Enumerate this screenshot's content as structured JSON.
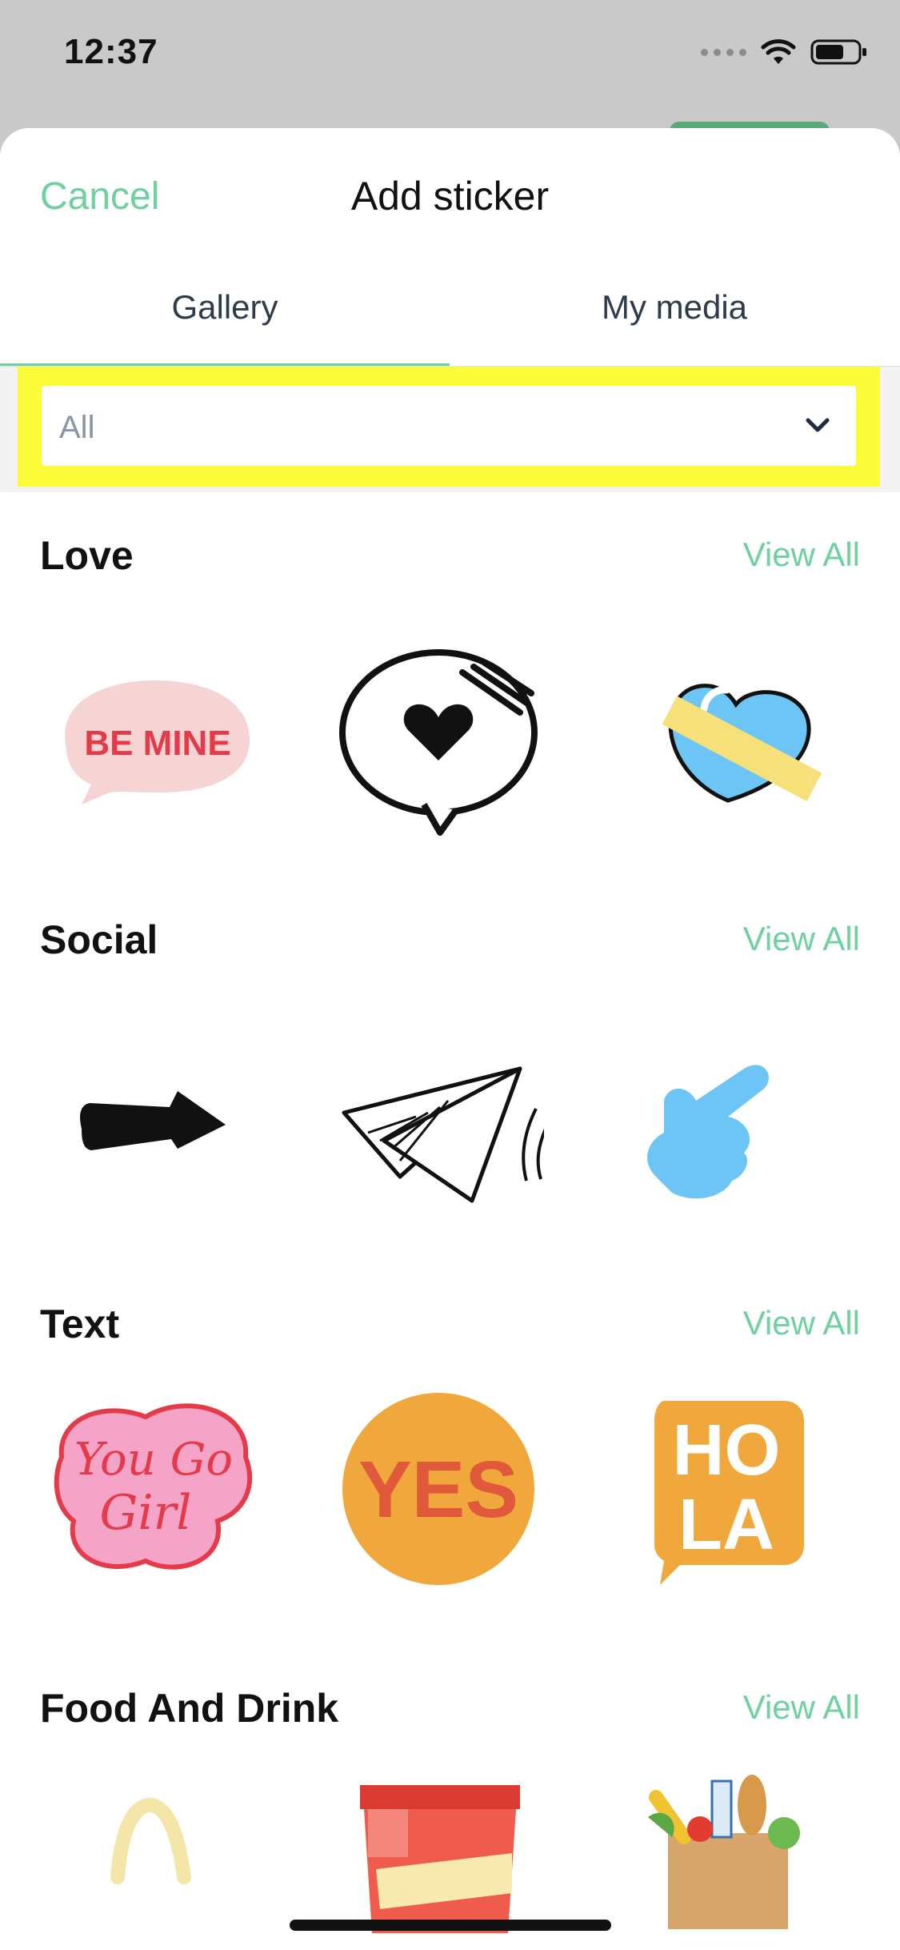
{
  "status": {
    "time": "12:37"
  },
  "nav": {
    "cancel": "Cancel",
    "title": "Add sticker"
  },
  "tabs": [
    {
      "label": "Gallery",
      "active": true
    },
    {
      "label": "My media",
      "active": false
    }
  ],
  "filter": {
    "value": "All"
  },
  "sections": [
    {
      "title": "Love",
      "view_all": "View All",
      "stickers": [
        "be-mine-speech-bubble",
        "heart-speech-bubble",
        "blue-heart-with-tape"
      ]
    },
    {
      "title": "Social",
      "view_all": "View All",
      "stickers": [
        "black-arrow",
        "paper-plane",
        "pointing-hand"
      ]
    },
    {
      "title": "Text",
      "view_all": "View All",
      "stickers": [
        "you-go-girl-text",
        "yes-circle",
        "hola-speech-bubble"
      ]
    },
    {
      "title": "Food And Drink",
      "view_all": "View All",
      "stickers": [
        "noodle",
        "snack-bag",
        "grocery-bag"
      ]
    }
  ],
  "sticker_text": {
    "be_mine": "BE MINE",
    "you_go_girl_1": "You Go",
    "you_go_girl_2": "Girl",
    "yes": "YES",
    "hola_1": "HO",
    "hola_2": "LA"
  },
  "colors": {
    "accent": "#6fd0a0",
    "highlight": "#fbfb3a",
    "sky_blue": "#6cc5f5",
    "orange": "#f0a83c",
    "pink": "#f5a3c7"
  }
}
